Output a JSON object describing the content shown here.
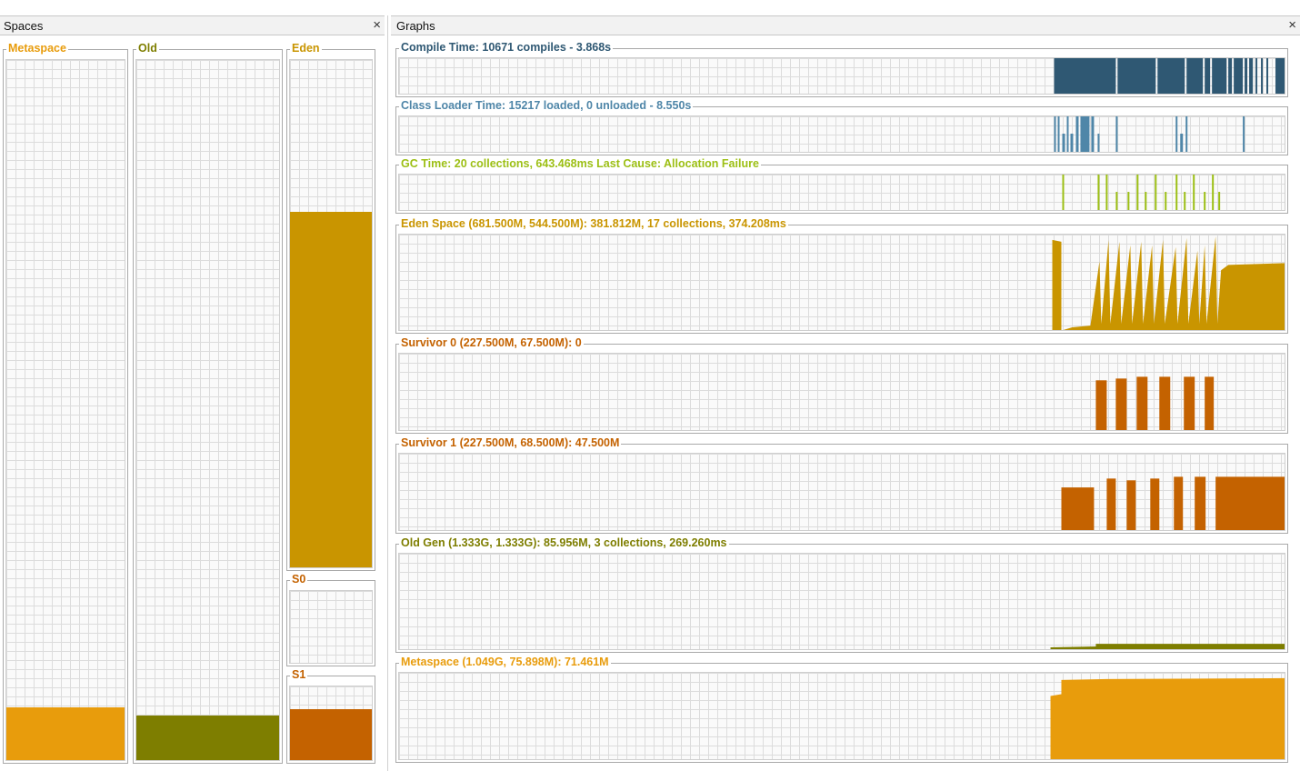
{
  "spaces_panel": {
    "title": "Spaces",
    "close_glyph": "×",
    "boxes": [
      {
        "label": "Metaspace",
        "color": "#e89c0c",
        "fill_fraction": 0.075
      },
      {
        "label": "Old",
        "color": "#7e7e00",
        "fill_fraction": 0.064
      },
      {
        "label": "Eden",
        "color": "#c99500",
        "fill_fraction": 0.7
      },
      {
        "label": "S0",
        "color": "#c46200",
        "fill_fraction": 0.0
      },
      {
        "label": "S1",
        "color": "#c46200",
        "fill_fraction": 0.69
      }
    ]
  },
  "graphs_panel": {
    "title": "Graphs",
    "close_glyph": "×",
    "graphs": [
      {
        "label": "Compile Time: 10671 compiles - 3.868s",
        "color": "#2f5873"
      },
      {
        "label": "Class Loader Time: 15217 loaded, 0 unloaded - 8.550s",
        "color": "#4f86a8"
      },
      {
        "label": "GC Time: 20 collections, 643.468ms Last Cause: Allocation Failure",
        "color": "#9cbf14"
      },
      {
        "label": "Eden Space (681.500M, 544.500M): 381.812M, 17 collections, 374.208ms",
        "color": "#c99500"
      },
      {
        "label": "Survivor 0 (227.500M, 67.500M): 0",
        "color": "#c46200"
      },
      {
        "label": "Survivor 1 (227.500M, 68.500M): 47.500M",
        "color": "#c46200"
      },
      {
        "label": "Old Gen (1.333G, 1.333G): 85.956M, 3 collections, 269.260ms",
        "color": "#7e7e00"
      },
      {
        "label": "Metaspace (1.049G, 75.898M): 71.461M",
        "color": "#e89c0c"
      }
    ]
  }
}
